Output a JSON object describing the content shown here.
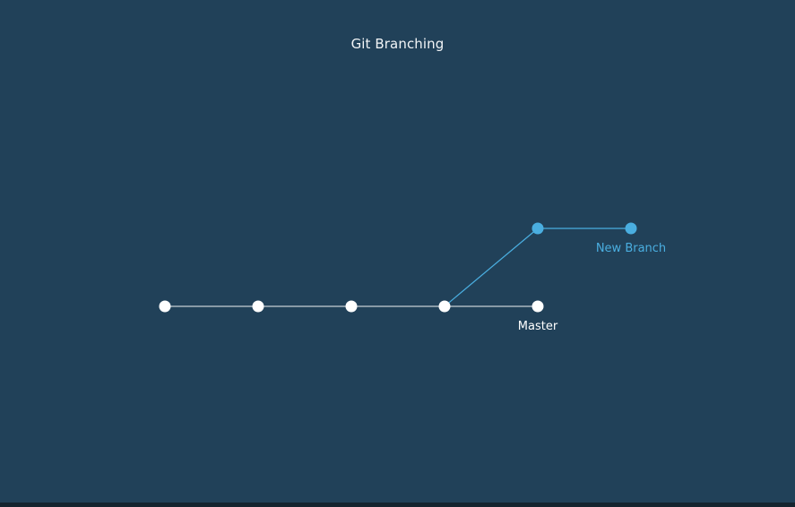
{
  "title": "Git Branching",
  "colors": {
    "background": "#214159",
    "master": "#ffffff",
    "branch": "#4aaee0"
  },
  "branches": {
    "master": {
      "label": "Master",
      "commit_count": 5,
      "label_at_commit": 4
    },
    "new_branch": {
      "label": "New Branch",
      "fork_from_commit": 3,
      "commit_count": 2,
      "label_at_commit": 1
    }
  }
}
